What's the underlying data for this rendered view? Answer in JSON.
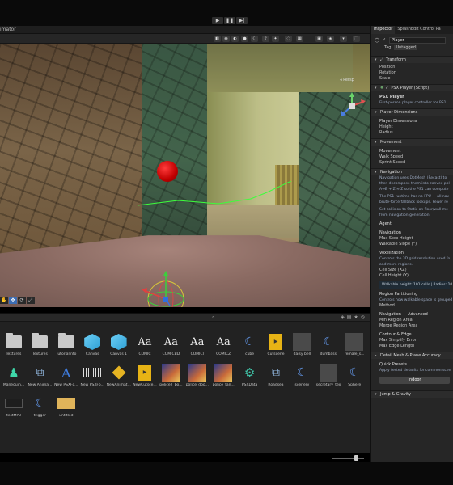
{
  "toolbar": {
    "play": "▶",
    "pause": "❚❚",
    "step": "▶|"
  },
  "scene_tab": {
    "label": "imator"
  },
  "scene_view": {
    "persp_label": "◂ Persp"
  },
  "scene_tools": [
    "✋",
    "✥",
    "⟳",
    "⤢"
  ],
  "project": {
    "search_icon": "search-icon",
    "assets_row1": [
      {
        "label": "Textures",
        "kind": "folder"
      },
      {
        "label": "Textures",
        "kind": "folder"
      },
      {
        "label": "TutorialInfo",
        "kind": "folder"
      },
      {
        "label": "Canvas",
        "kind": "cube"
      },
      {
        "label": "Canvas 1",
        "kind": "cube"
      },
      {
        "label": "COMIC",
        "kind": "font"
      },
      {
        "label": "COMICBD",
        "kind": "font"
      },
      {
        "label": "COMICI",
        "kind": "font"
      },
      {
        "label": "COMICZ",
        "kind": "font"
      },
      {
        "label": "cube",
        "kind": "moon"
      },
      {
        "label": "Cutscene",
        "kind": "cs"
      },
      {
        "label": "daisy bell",
        "kind": "dark"
      },
      {
        "label": "dumbass",
        "kind": "moon"
      },
      {
        "label": "female_s...",
        "kind": "dark"
      }
    ],
    "assets_row2": [
      {
        "label": "Manequin...",
        "kind": "human"
      },
      {
        "label": "New Anima...",
        "kind": "diag"
      },
      {
        "label": "New PSXFo...",
        "kind": "letter"
      },
      {
        "label": "New PSXFo...",
        "kind": "dots"
      },
      {
        "label": "NewAnimat...",
        "kind": "diamond"
      },
      {
        "label": "NewCutsce...",
        "kind": "cs"
      },
      {
        "label": "police2_bo...",
        "kind": "png"
      },
      {
        "label": "police_doo...",
        "kind": "png"
      },
      {
        "label": "police_fan...",
        "kind": "png"
      },
      {
        "label": "PSXData",
        "kind": "cog"
      },
      {
        "label": "Roadsea",
        "kind": "diag"
      },
      {
        "label": "scenery",
        "kind": "moon"
      },
      {
        "label": "secretary_tex",
        "kind": "dark"
      },
      {
        "label": "Sphere",
        "kind": "moon"
      },
      {
        "label": "Spheres",
        "kind": "dark"
      }
    ],
    "assets_row3": [
      {
        "label": "testMP3",
        "kind": "wave"
      },
      {
        "label": "trigger",
        "kind": "moon"
      },
      {
        "label": "untitled",
        "kind": "audio"
      }
    ]
  },
  "inspector": {
    "tabs": [
      "Inspector",
      "SplashEdit Control Pa"
    ],
    "object_name": "Player",
    "tag_label": "Tag",
    "tag_value": "Untagged",
    "transform": {
      "title": "Transform",
      "fields": [
        "Position",
        "Rotation",
        "Scale"
      ]
    },
    "script": {
      "title": "PSX Player (Script)",
      "name": "PSX Player",
      "desc": "First-person player controller for PS1"
    },
    "player_dimensions": {
      "title": "Player Dimensions",
      "sub": "Player Dimensions",
      "fields": [
        "Height",
        "Radius"
      ]
    },
    "movement": {
      "title": "Movement",
      "sub": "Movement",
      "fields": [
        "Walk Speed",
        "Sprint Speed"
      ]
    },
    "navigation": {
      "title": "Navigation",
      "desc1": "Navigation uses DotMesh (Recast) to",
      "desc2": "then decompose them into convex pol",
      "desc3": "A→B + Z ≈ Z so the PS1 can compute",
      "desc4": "The PS1 runtime has no FPU — all nav",
      "desc5": "brute-force fallback lookups. Fewer re",
      "desc6": "Set collision to Static on floor/wall me",
      "desc7": "from navigation generation.",
      "agent": "Agent",
      "nav_sub": "Navigation",
      "nav_fields": [
        "Max Step Height",
        "Walkable Slope (°)"
      ],
      "vox_sub": "Voxelization",
      "vox_desc1": "Controls the 3D grid resolution used fo",
      "vox_desc2": "and more regions.",
      "vox_fields": [
        "Cell Size (XZ)",
        "Cell Height (Y)"
      ],
      "info": "Walkable height: 101 cells  |  Radius: 10 ce",
      "region_sub": "Region Partitioning",
      "region_desc": "Controls how walkable space is grouped",
      "region_fields": [
        "Method"
      ],
      "adv_sub": "Navigation — Advanced",
      "adv_fields": [
        "Min Region Area",
        "Merge Region Area"
      ],
      "contour_sub": "Contour & Edge",
      "contour_fields": [
        "Max Simplify Error",
        "Max Edge Length"
      ]
    },
    "detail": {
      "title": "Detail Mesh & Plane Accuracy"
    },
    "presets": {
      "sub": "Quick Presets",
      "desc": "Apply tested defaults for common scen",
      "button": "Indoor"
    },
    "jump": {
      "title": "Jump & Gravity"
    }
  }
}
